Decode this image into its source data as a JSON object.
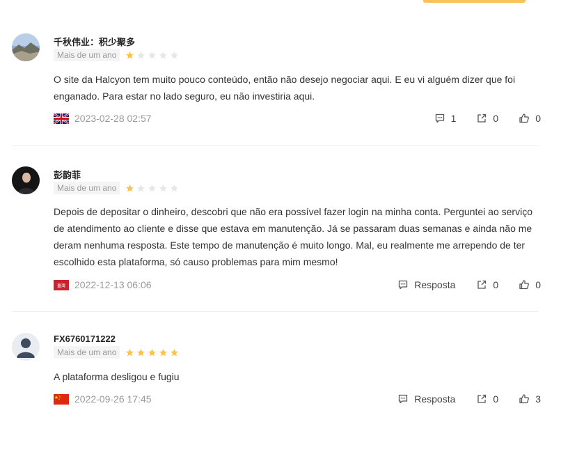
{
  "reviews": [
    {
      "author": "千秋伟业：积少聚多",
      "time_tag": "Mais de um ano",
      "rating": 1,
      "text": "O site da Halcyon tem muito pouco conteúdo, então não desejo negociar aqui. E eu vi alguém dizer que foi enganado. Para estar no lado seguro, eu não investiria aqui.",
      "date": "2023-02-28 02:57",
      "flag": "uk-flag-icon",
      "reply_label": "1",
      "share_count": "0",
      "like_count": "0"
    },
    {
      "author": "彭韵菲",
      "time_tag": "Mais de um ano",
      "rating": 1,
      "text": "Depois de depositar o dinheiro, descobri que não era possível fazer login na minha conta. Perguntei ao serviço de atendimento ao cliente e disse que estava em manutenção. Já se passaram duas semanas e ainda não me deram nenhuma resposta. Este tempo de manutenção é muito longo. Mal, eu realmente me arrependo de ter escolhido esta plataforma, só causo problemas para mim mesmo!",
      "date": "2022-12-13 06:06",
      "flag": "taiwan-region-flag-icon",
      "flag_text": "臺灣",
      "reply_label": "Resposta",
      "share_count": "0",
      "like_count": "0"
    },
    {
      "author": "FX6760171222",
      "time_tag": "Mais de um ano",
      "rating": 5,
      "text": "A plataforma desligou e fugiu",
      "date": "2022-09-26 17:45",
      "flag": "china-flag-icon",
      "reply_label": "Resposta",
      "share_count": "0",
      "like_count": "3"
    }
  ],
  "colors": {
    "star_filled": "#f8c34a",
    "star_empty": "#e6e6e6",
    "accent_bar": "#f8c45a"
  }
}
